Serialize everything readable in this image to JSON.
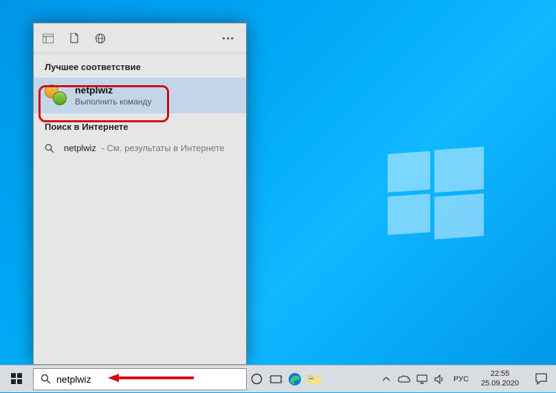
{
  "search": {
    "section_best": "Лучшее соответствие",
    "best_result": {
      "title": "netplwiz",
      "subtitle": "Выполнить команду"
    },
    "section_web": "Поиск в Интернете",
    "web_result": {
      "query": "netplwiz",
      "desc": "- См. результаты в Интернете"
    },
    "input_value": "netplwiz"
  },
  "taskbar": {
    "lang": "РУС",
    "time": "22:55",
    "date": "25.09.2020"
  }
}
